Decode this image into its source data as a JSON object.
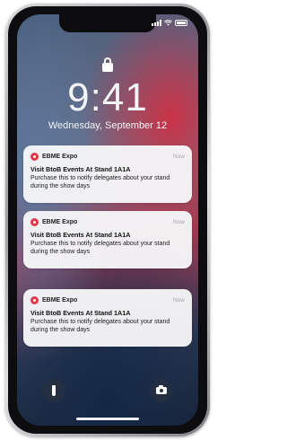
{
  "lockscreen": {
    "time": "9:41",
    "date": "Wednesday, September 12"
  },
  "notifications": [
    {
      "app": "EBME Expo",
      "when": "Now",
      "title": "Visit BtoB Events At Stand 1A1A",
      "body": "Purchase this to notify delegates about your stand during the show days"
    },
    {
      "app": "EBME Expo",
      "when": "Now",
      "title": "Visit BtoB Events At Stand 1A1A",
      "body": "Purchase this to notify delegates about your stand during the show days"
    },
    {
      "app": "EBME Expo",
      "when": "Now",
      "title": "Visit BtoB Events At Stand 1A1A",
      "body": "Purchase this to notify delegates about your stand during the show days"
    }
  ],
  "icons": {
    "lock": "lock-icon",
    "flashlight": "flashlight-icon",
    "camera": "camera-icon",
    "app": "ebme-app-icon"
  },
  "colors": {
    "app_accent": "#e2384b",
    "card_background": "#f5f5f7"
  }
}
